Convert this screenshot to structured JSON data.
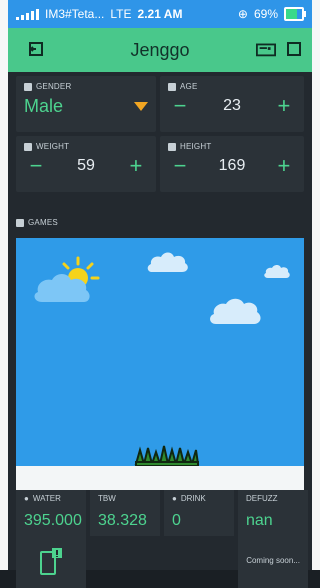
{
  "status_bar": {
    "carrier": "IM3#Teta...",
    "network": "LTE",
    "time": "2.21 AM",
    "battery_percent": "69%",
    "battery_level": 0.69
  },
  "app": {
    "title": "Jenggo"
  },
  "fields": {
    "gender": {
      "label": "GENDER",
      "value": "Male"
    },
    "age": {
      "label": "AGE",
      "value": "23"
    },
    "weight": {
      "label": "WEIGHT",
      "value": "59"
    },
    "height": {
      "label": "HEIGHT",
      "value": "169"
    },
    "games": {
      "label": "GAMES"
    }
  },
  "metrics": [
    {
      "label": "WATER",
      "value": "395.000"
    },
    {
      "label": "TBW",
      "value": "38.328"
    },
    {
      "label": "DRINK",
      "value": "0"
    },
    {
      "label": "DEFUZZ",
      "value": "nan"
    }
  ],
  "footer": {
    "coming_soon": "Coming soon..."
  },
  "colors": {
    "status_bar": "#2f95e8",
    "header": "#49c88b",
    "accent_green": "#4dd38f",
    "panel_bg": "#23292f",
    "widget_bg": "#2b3238",
    "dropdown_arrow": "#f2a622",
    "sky": "#2f9be8"
  }
}
